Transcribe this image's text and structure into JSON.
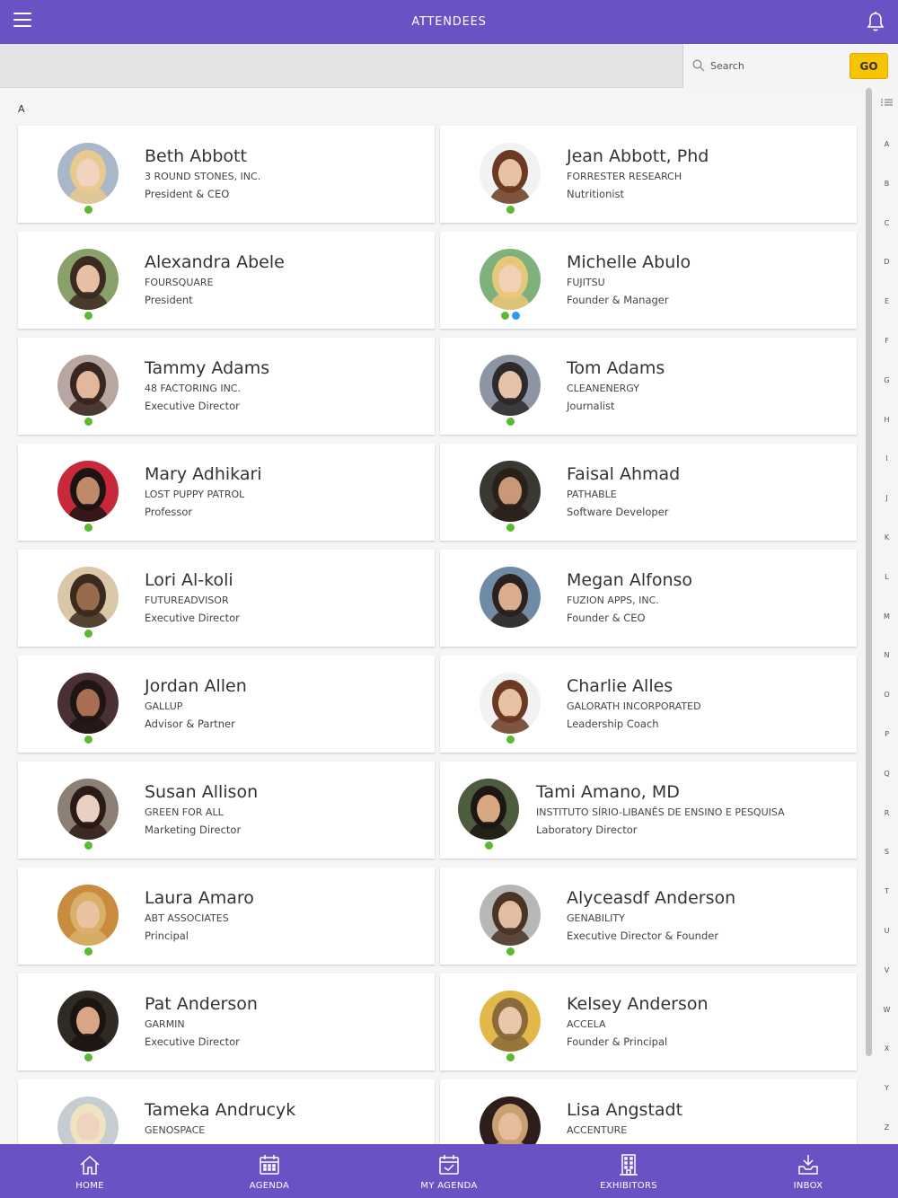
{
  "header": {
    "title": "ATTENDEES"
  },
  "search": {
    "placeholder": "Search",
    "go_label": "GO"
  },
  "section_letter": "A",
  "status_colors": {
    "online": "#5bb932",
    "secondary": "#2f9be8"
  },
  "attendees": [
    {
      "name": "Beth Abbott",
      "company": "3 ROUND STONES, INC.",
      "role": "President & CEO",
      "statuses": [
        "online"
      ],
      "avatar_colors": [
        "#a9b7c9",
        "#e8c98e",
        "#f1d3bf"
      ]
    },
    {
      "name": "Jean Abbott, Phd",
      "company": "FORRESTER RESEARCH",
      "role": "Nutritionist",
      "statuses": [
        "online"
      ],
      "avatar_colors": [
        "#f2f2f2",
        "#6b3a22",
        "#e9c2a6"
      ]
    },
    {
      "name": "Alexandra Abele",
      "company": "FOURSQUARE",
      "role": "President",
      "statuses": [
        "online"
      ],
      "avatar_colors": [
        "#8aa06a",
        "#3b2a20",
        "#e7bfa4"
      ]
    },
    {
      "name": "Michelle Abulo",
      "company": "FUJITSU",
      "role": "Founder & Manager",
      "statuses": [
        "online",
        "secondary"
      ],
      "avatar_colors": [
        "#7fb27a",
        "#e9c77a",
        "#f3cfb4"
      ]
    },
    {
      "name": "Tammy Adams",
      "company": "48 FACTORING INC.",
      "role": "Executive Director",
      "statuses": [
        "online"
      ],
      "avatar_colors": [
        "#b8a7a0",
        "#3a2620",
        "#e2b79c"
      ]
    },
    {
      "name": "Tom Adams",
      "company": "CLEANENERGY",
      "role": "Journalist",
      "statuses": [
        "online"
      ],
      "avatar_colors": [
        "#8c96a3",
        "#2c2a2a",
        "#e6c2a8"
      ]
    },
    {
      "name": "Mary Adhikari",
      "company": "LOST PUPPY PATROL",
      "role": "Professor",
      "statuses": [
        "online"
      ],
      "avatar_colors": [
        "#c7283a",
        "#1d1412",
        "#c08a6a"
      ]
    },
    {
      "name": "Faisal Ahmad",
      "company": "PATHABLE",
      "role": "Software Developer",
      "statuses": [
        "online"
      ],
      "avatar_colors": [
        "#3a3833",
        "#2a201a",
        "#c9987a"
      ]
    },
    {
      "name": "Lori Al-koli",
      "company": "FUTUREADVISOR",
      "role": "Executive Director",
      "statuses": [
        "online"
      ],
      "avatar_colors": [
        "#d9c7a8",
        "#3b2b1f",
        "#9a6a4d"
      ]
    },
    {
      "name": "Megan Alfonso",
      "company": "FUZION APPS, INC.",
      "role": "Founder & CEO",
      "statuses": [],
      "avatar_colors": [
        "#6f8ba5",
        "#2b2220",
        "#dcae90"
      ]
    },
    {
      "name": "Jordan Allen",
      "company": "GALLUP",
      "role": "Advisor & Partner",
      "statuses": [
        "online"
      ],
      "avatar_colors": [
        "#4a2f35",
        "#1f1513",
        "#a86f52"
      ]
    },
    {
      "name": "Charlie Alles",
      "company": "GALORATH INCORPORATED",
      "role": "Leadership Coach",
      "statuses": [
        "online"
      ],
      "avatar_colors": [
        "#f2f2f2",
        "#6b3a22",
        "#e9c2a6"
      ]
    },
    {
      "name": "Susan Allison",
      "company": "GREEN FOR ALL",
      "role": "Marketing Director",
      "statuses": [
        "online"
      ],
      "avatar_colors": [
        "#8b7f76",
        "#2b1a16",
        "#ead0c2"
      ]
    },
    {
      "name": "Tami Amano, MD",
      "company": "INSTITUTO SÍRIO-LIBANÊS DE ENSINO E PESQUISA",
      "role": "Laboratory Director",
      "statuses": [
        "online"
      ],
      "avatar_colors": [
        "#4d5c3f",
        "#1d1612",
        "#d9a883"
      ]
    },
    {
      "name": "Laura Amaro",
      "company": "ABT ASSOCIATES",
      "role": "Principal",
      "statuses": [
        "online"
      ],
      "avatar_colors": [
        "#c98b3d",
        "#d8b06a",
        "#eac2a2"
      ]
    },
    {
      "name": "Alyceasdf Anderson",
      "company": "GENABILITY",
      "role": "Executive Director & Founder",
      "statuses": [
        "online"
      ],
      "avatar_colors": [
        "#b7b7b7",
        "#4b3426",
        "#e3bda3"
      ]
    },
    {
      "name": "Pat Anderson",
      "company": "GARMIN",
      "role": "Executive Director",
      "statuses": [
        "online"
      ],
      "avatar_colors": [
        "#2f2a24",
        "#1c1411",
        "#d8a585"
      ]
    },
    {
      "name": "Kelsey Anderson",
      "company": "ACCELA",
      "role": "Founder & Principal",
      "statuses": [
        "online"
      ],
      "avatar_colors": [
        "#e0b94a",
        "#8a6a3a",
        "#eac7a8"
      ]
    },
    {
      "name": "Tameka Andrucyk",
      "company": "GENOSPACE",
      "role": "",
      "statuses": [],
      "avatar_colors": [
        "#c6cdd2",
        "#efe3c0",
        "#f0d3bf"
      ]
    },
    {
      "name": "Lisa Angstadt",
      "company": "ACCENTURE",
      "role": "",
      "statuses": [],
      "avatar_colors": [
        "#2d1e1c",
        "#caa070",
        "#e6bd9c"
      ]
    }
  ],
  "index_letters": [
    "A",
    "B",
    "C",
    "D",
    "E",
    "F",
    "G",
    "H",
    "I",
    "J",
    "K",
    "L",
    "M",
    "N",
    "O",
    "P",
    "Q",
    "R",
    "S",
    "T",
    "U",
    "V",
    "W",
    "X",
    "Y",
    "Z"
  ],
  "bottom_nav": [
    {
      "label": "HOME",
      "icon": "home-icon"
    },
    {
      "label": "AGENDA",
      "icon": "calendar-icon"
    },
    {
      "label": "MY AGENDA",
      "icon": "calendar-check-icon"
    },
    {
      "label": "EXHIBITORS",
      "icon": "building-icon"
    },
    {
      "label": "INBOX",
      "icon": "inbox-icon"
    }
  ]
}
